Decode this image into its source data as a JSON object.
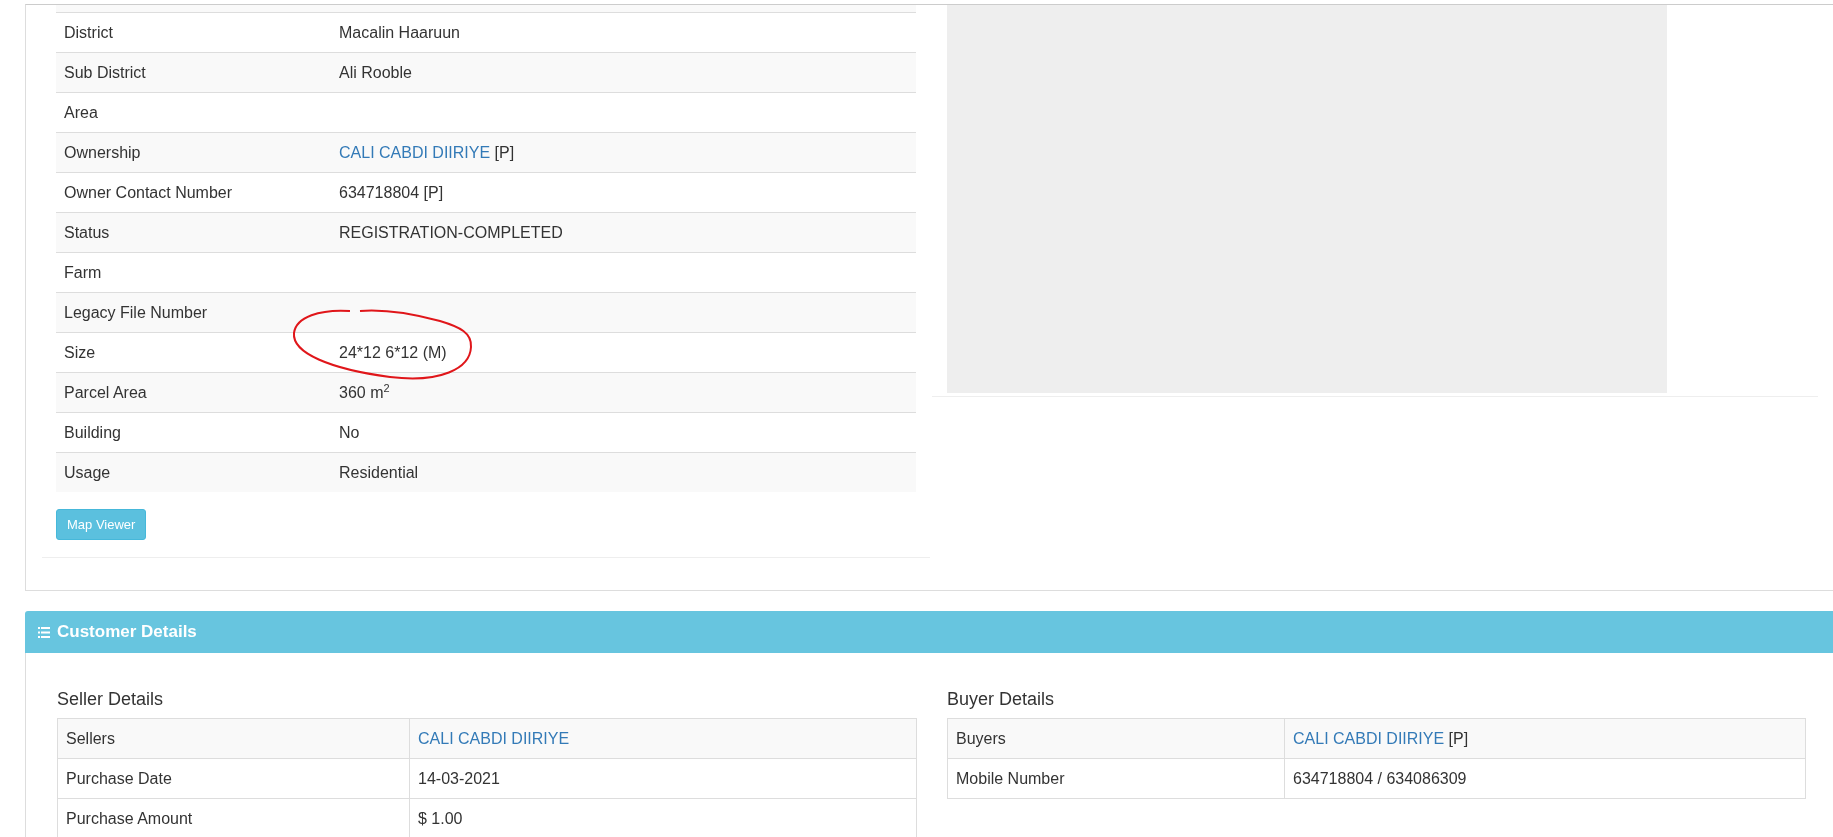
{
  "property_details": {
    "rows": [
      {
        "label": "District",
        "value": "Macalin Haaruun",
        "circled": false
      },
      {
        "label": "Sub District",
        "value": "Ali Rooble",
        "circled": false
      },
      {
        "label": "Area",
        "circled": false
      },
      {
        "label": "Ownership",
        "link": "CALI CABDI DIIRIYE",
        "value": "[P]",
        "circled": false
      },
      {
        "label": "Owner Contact Number",
        "value": "634718804 [P]",
        "circled": false
      },
      {
        "label": "Status",
        "value": "REGISTRATION-COMPLETED",
        "circled": false
      },
      {
        "label": "Farm",
        "circled": false
      },
      {
        "label": "Legacy File Number",
        "circled": false
      },
      {
        "label": "Size",
        "value": "24*12 6*12 (M)",
        "circled": true
      },
      {
        "label": "Parcel Area",
        "value": "360 m$^{2}$",
        "circled": false
      },
      {
        "label": "Building",
        "value": "No",
        "circled": false
      },
      {
        "label": "Usage",
        "value": "Residential",
        "circled": false
      }
    ],
    "button": "Map Viewer"
  },
  "customer_details": {
    "title": "Customer Details",
    "seller": {
      "heading": "Seller Details",
      "rows": [
        {
          "label": "Sellers",
          "link": "CALI CABDI DIIRIYE"
        },
        {
          "label": "Purchase Date",
          "value": "14-03-2021"
        },
        {
          "label": "Purchase Amount",
          "value": "$ 1.00"
        }
      ]
    },
    "buyer": {
      "heading": "Buyer Details",
      "rows": [
        {
          "label": "Buyers",
          "link": "CALI CABDI DIIRIYE",
          "value": "[P]"
        },
        {
          "label": "Mobile Number",
          "value": "634718804 / 634086309"
        }
      ]
    }
  }
}
